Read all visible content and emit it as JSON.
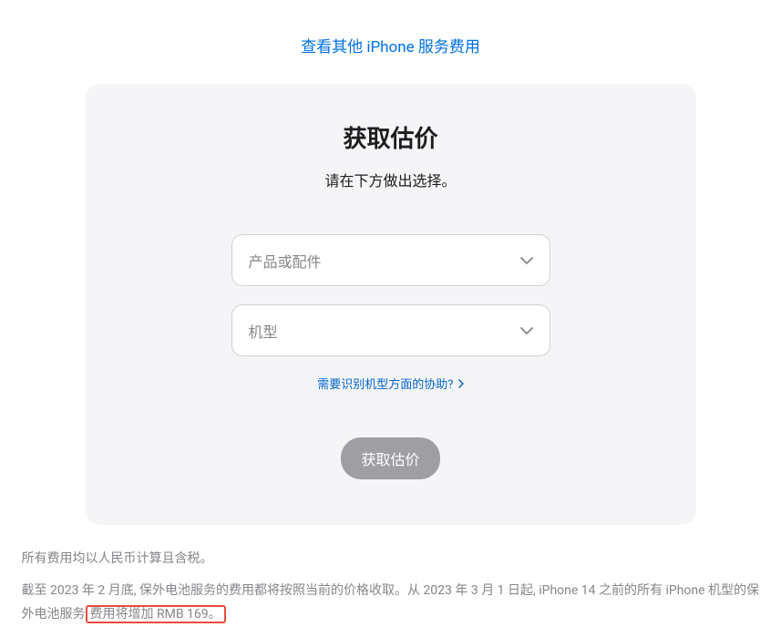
{
  "top_link": {
    "label": "查看其他 iPhone 服务费用"
  },
  "card": {
    "title": "获取估价",
    "subtitle": "请在下方做出选择。",
    "select_product_placeholder": "产品或配件",
    "select_model_placeholder": "机型",
    "help_link_label": "需要识别机型方面的协助?",
    "button_label": "获取估价"
  },
  "footer": {
    "line1": "所有费用均以人民币计算且含税。",
    "line2_part1": "截至 2023 年 2 月底, 保外电池服务的费用都将按照当前的价格收取。从 2023 年 3 月 1 日起, iPhone 14 之前的所有 iPhone 机型的保外电池服务",
    "line2_highlight": "费用将增加 RMB 169。"
  }
}
